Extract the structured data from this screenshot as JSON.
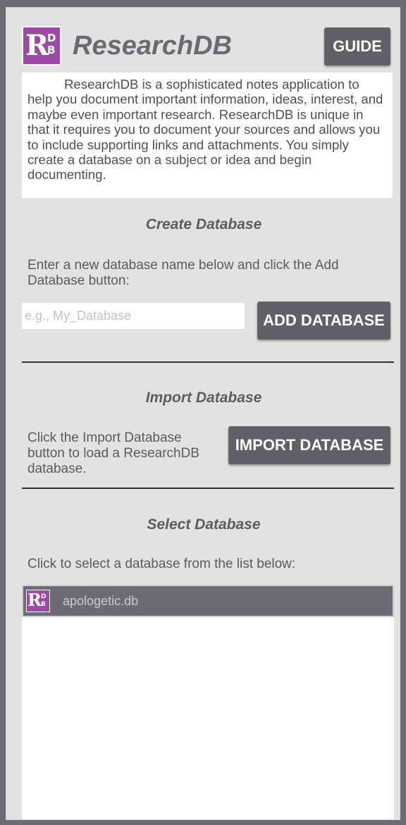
{
  "header": {
    "logo": {
      "big_letter": "R",
      "small_top": "D",
      "small_bottom": "B"
    },
    "app_title": "ResearchDB",
    "guide_label": "GUIDE"
  },
  "intro": {
    "text": "ResearchDB is a sophisticated notes application to help you document important information, ideas, interest, and maybe even important research. ResearchDB is unique in that it requires you to document your sources and allows you to include supporting links and attachments. You simply create a database on a subject or idea and begin documenting."
  },
  "create": {
    "title": "Create Database",
    "instructions": "Enter a new database name below and click the Add Database button:",
    "input_placeholder": "e.g., My_Database",
    "input_value": "",
    "button_label": "ADD DATABASE"
  },
  "import": {
    "title": "Import Database",
    "instructions": "Click the Import Database button to load a ResearchDB database.",
    "button_label": "IMPORT DATABASE"
  },
  "select": {
    "title": "Select Database",
    "instructions": "Click to select a database from the list below:",
    "items": [
      {
        "name": "apologetic.db",
        "icon": "researchdb-logo-icon"
      }
    ]
  },
  "colors": {
    "brand_purple": "#9b4aa6",
    "button_gray": "#606068",
    "panel_bg": "#e2e2e2",
    "title_gray": "#6a6a72"
  }
}
